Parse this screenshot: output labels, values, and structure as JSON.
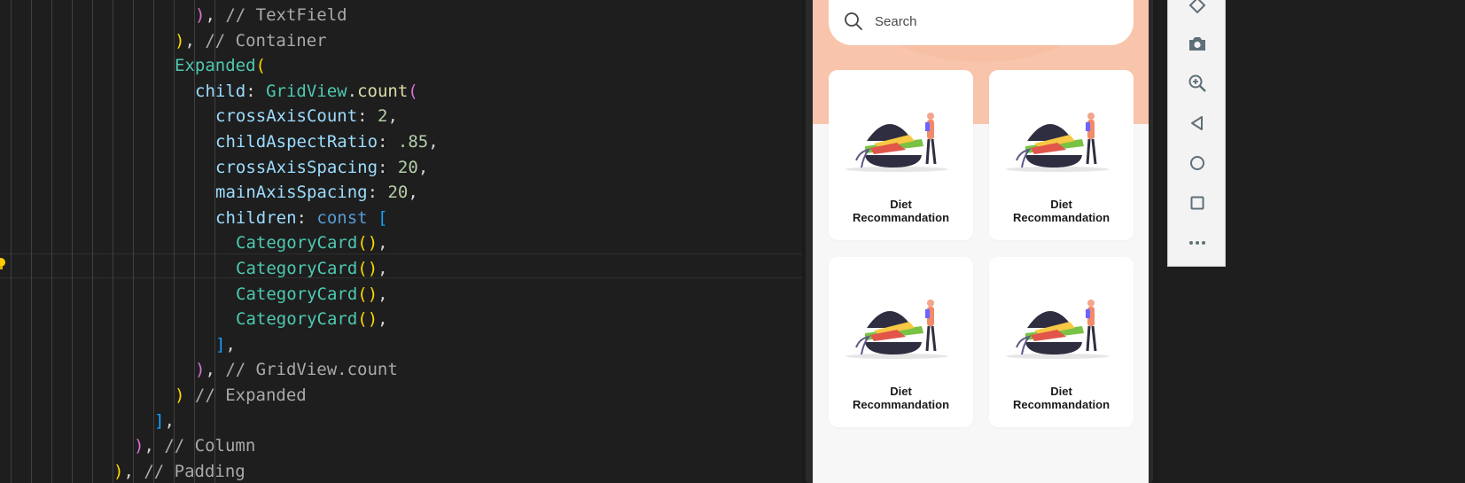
{
  "editor": {
    "lines": [
      {
        "tokens": [
          {
            "t": ")",
            "c": "tok-m"
          },
          {
            "t": ", ",
            "c": "tok-punct"
          },
          {
            "t": "// TextField",
            "c": "tok-cmt"
          }
        ]
      },
      {
        "tokens": [
          {
            "t": ")",
            "c": "tok-y"
          },
          {
            "t": ", ",
            "c": "tok-punct"
          },
          {
            "t": "// Container",
            "c": "tok-cmt"
          }
        ]
      },
      {
        "tokens": [
          {
            "t": "Expanded",
            "c": "tok-cls"
          },
          {
            "t": "(",
            "c": "tok-y"
          }
        ]
      },
      {
        "tokens": [
          {
            "t": "child",
            "c": "tok-prop"
          },
          {
            "t": ": ",
            "c": "tok-punct"
          },
          {
            "t": "GridView",
            "c": "tok-cls"
          },
          {
            "t": ".",
            "c": "tok-punct"
          },
          {
            "t": "count",
            "c": "tok-fn"
          },
          {
            "t": "(",
            "c": "tok-m"
          }
        ]
      },
      {
        "tokens": [
          {
            "t": "crossAxisCount",
            "c": "tok-prop"
          },
          {
            "t": ": ",
            "c": "tok-punct"
          },
          {
            "t": "2",
            "c": "tok-num"
          },
          {
            "t": ",",
            "c": "tok-punct"
          }
        ]
      },
      {
        "tokens": [
          {
            "t": "childAspectRatio",
            "c": "tok-prop"
          },
          {
            "t": ": ",
            "c": "tok-punct"
          },
          {
            "t": ".85",
            "c": "tok-num"
          },
          {
            "t": ",",
            "c": "tok-punct"
          }
        ]
      },
      {
        "tokens": [
          {
            "t": "crossAxisSpacing",
            "c": "tok-prop"
          },
          {
            "t": ": ",
            "c": "tok-punct"
          },
          {
            "t": "20",
            "c": "tok-num"
          },
          {
            "t": ",",
            "c": "tok-punct"
          }
        ]
      },
      {
        "tokens": [
          {
            "t": "mainAxisSpacing",
            "c": "tok-prop"
          },
          {
            "t": ": ",
            "c": "tok-punct"
          },
          {
            "t": "20",
            "c": "tok-num"
          },
          {
            "t": ",",
            "c": "tok-punct"
          }
        ]
      },
      {
        "tokens": [
          {
            "t": "children",
            "c": "tok-prop"
          },
          {
            "t": ": ",
            "c": "tok-punct"
          },
          {
            "t": "const",
            "c": "tok-kw"
          },
          {
            "t": " ",
            "c": "tok-punct"
          },
          {
            "t": "[",
            "c": "tok-b"
          }
        ]
      },
      {
        "tokens": [
          {
            "t": "CategoryCard",
            "c": "tok-cls"
          },
          {
            "t": "()",
            "c": "tok-y"
          },
          {
            "t": ",",
            "c": "tok-punct"
          }
        ]
      },
      {
        "tokens": [
          {
            "t": "CategoryCard",
            "c": "tok-cls"
          },
          {
            "t": "()",
            "c": "tok-y"
          },
          {
            "t": ",",
            "c": "tok-punct"
          }
        ]
      },
      {
        "tokens": [
          {
            "t": "CategoryCard",
            "c": "tok-cls"
          },
          {
            "t": "()",
            "c": "tok-y"
          },
          {
            "t": ",",
            "c": "tok-punct"
          }
        ]
      },
      {
        "tokens": [
          {
            "t": "CategoryCard",
            "c": "tok-cls"
          },
          {
            "t": "()",
            "c": "tok-y"
          },
          {
            "t": ",",
            "c": "tok-punct"
          }
        ]
      },
      {
        "tokens": [
          {
            "t": "]",
            "c": "tok-b"
          },
          {
            "t": ",",
            "c": "tok-punct"
          }
        ]
      },
      {
        "tokens": [
          {
            "t": ")",
            "c": "tok-m"
          },
          {
            "t": ", ",
            "c": "tok-punct"
          },
          {
            "t": "// GridView.count",
            "c": "tok-cmt"
          }
        ]
      },
      {
        "tokens": [
          {
            "t": ")",
            "c": "tok-y"
          },
          {
            "t": " ",
            "c": "tok-punct"
          },
          {
            "t": "// Expanded",
            "c": "tok-cmt"
          }
        ]
      },
      {
        "tokens": [
          {
            "t": "]",
            "c": "tok-b"
          },
          {
            "t": ",",
            "c": "tok-punct"
          }
        ]
      },
      {
        "tokens": [
          {
            "t": ")",
            "c": "tok-m"
          },
          {
            "t": ", ",
            "c": "tok-punct"
          },
          {
            "t": "// Column",
            "c": "tok-cmt"
          }
        ]
      },
      {
        "tokens": [
          {
            "t": ")",
            "c": "tok-y"
          },
          {
            "t": ", ",
            "c": "tok-punct"
          },
          {
            "t": "// Padding",
            "c": "tok-cmt"
          }
        ]
      }
    ]
  },
  "app": {
    "search_placeholder": "Search",
    "cards": [
      {
        "line1": "Diet",
        "line2": "Recommandation"
      },
      {
        "line1": "Diet",
        "line2": "Recommandation"
      },
      {
        "line1": "Diet",
        "line2": "Recommandation"
      },
      {
        "line1": "Diet",
        "line2": "Recommandation"
      }
    ]
  },
  "emulator_toolbar": {
    "buttons": [
      "rotate-icon",
      "camera-icon",
      "zoom-icon",
      "back-icon",
      "home-icon",
      "overview-icon",
      "more-icon"
    ]
  },
  "colors": {
    "accent_header": "#f8c5ac",
    "editor_bg": "#1e1e1e"
  }
}
